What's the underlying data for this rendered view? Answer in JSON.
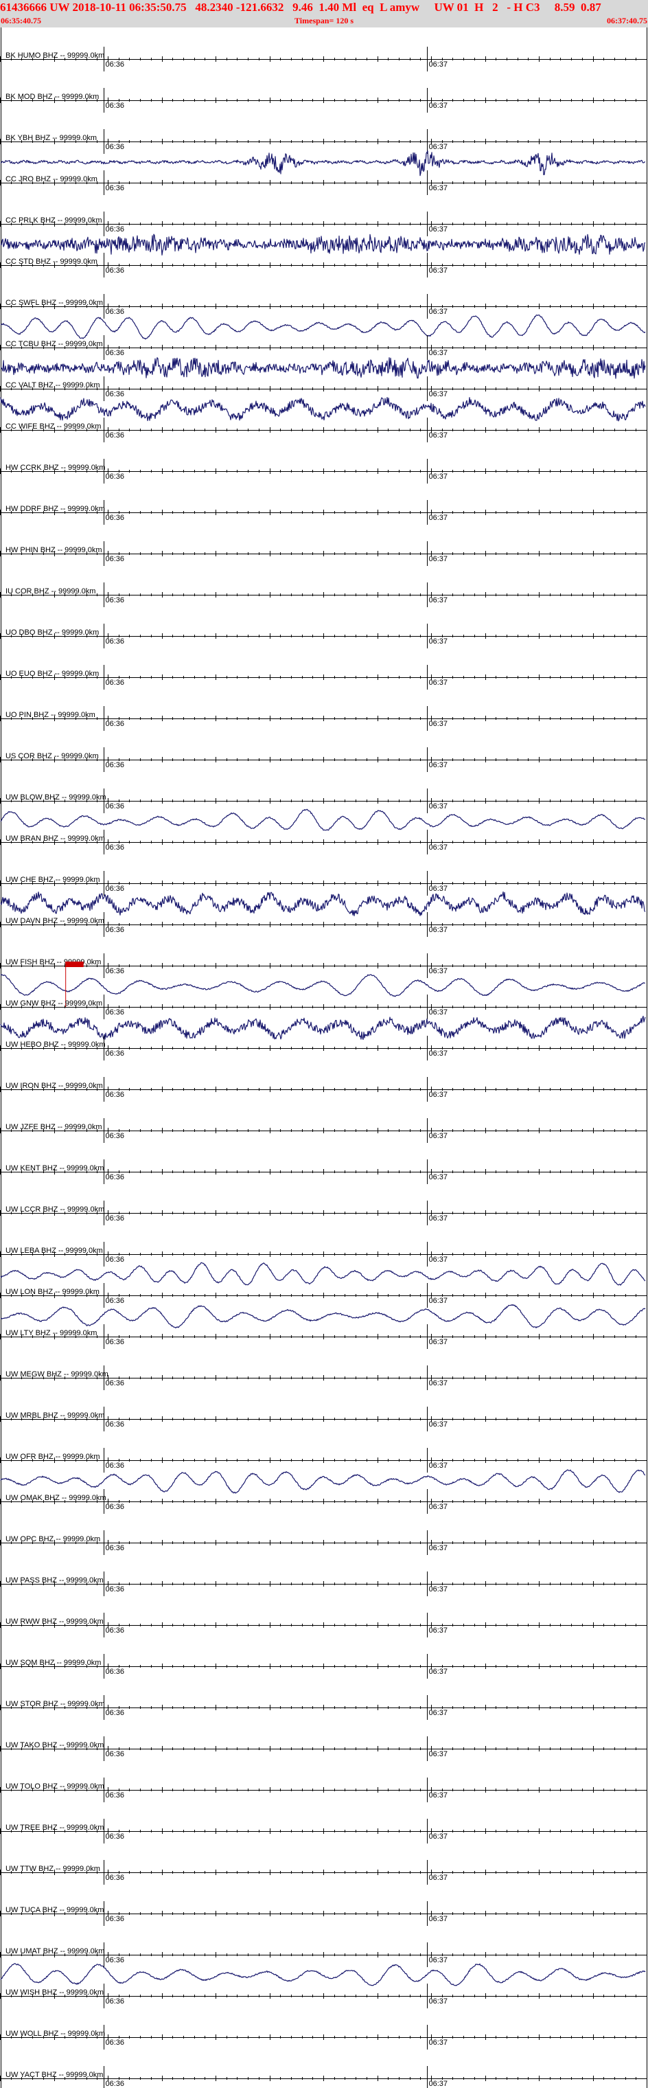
{
  "header": {
    "title_text": "61436666 UW 2018-10-11 06:35:50.75   48.2340 -121.6632   9.46  1.40 Ml  eq  L amyw     UW 01  H   2   - H C3     8.59  0.87",
    "start_time": "06:35:40.75",
    "timespan": "Timespan= 120 s",
    "end_time": "06:37:40.75"
  },
  "colors": {
    "header_background": "#d8d8d8",
    "header_text": "#ff0000",
    "trace": "#1a1a6e",
    "axis": "#000000",
    "pick": "#cc0000"
  },
  "chart_data": {
    "type": "line",
    "title": "61436666 UW 2018-10-11 06:35:50.75   48.2340 -121.6632   9.46  1.40 Ml  eq  L amyw     UW 01  H   2   - H C3     8.59  0.87",
    "x_start": "06:35:40.75",
    "x_end": "06:37:40.75",
    "timespan_seconds": 120,
    "time_tick_labels": [
      "06:36",
      "06:37"
    ],
    "time_tick_seconds": [
      19.25,
      79.25
    ],
    "grid": false,
    "channels": [
      {
        "label": "BK HUMO BHZ -- 99999.0km",
        "waveform": "none"
      },
      {
        "label": "BK MOD BHZ -- 99999.0km",
        "waveform": "none"
      },
      {
        "label": "BK YBH BHZ -- 99999.0km",
        "waveform": "noise-bursts"
      },
      {
        "label": "CC JRO BHZ -- 99999.0km",
        "waveform": "none"
      },
      {
        "label": "CC PRLK BHZ -- 99999.0km",
        "waveform": "high-noise"
      },
      {
        "label": "CC STD BHZ -- 99999.0km",
        "waveform": "none"
      },
      {
        "label": "CC SWFL BHZ -- 99999.0km",
        "waveform": "oscillation"
      },
      {
        "label": "CC TCBU BHZ -- 99999.0km",
        "waveform": "high-noise"
      },
      {
        "label": "CC VALT BHZ -- 99999.0km",
        "waveform": "noisy-oscillation"
      },
      {
        "label": "CC WIFE BHZ -- 99999.0km",
        "waveform": "none"
      },
      {
        "label": "HW CCRK BHZ -- 99999.0km",
        "waveform": "none"
      },
      {
        "label": "HW DDRF BHZ -- 99999.0km",
        "waveform": "none"
      },
      {
        "label": "HW PHIN BHZ -- 99999.0km",
        "waveform": "none"
      },
      {
        "label": "IU COR BHZ -- 99999.0km",
        "waveform": "none"
      },
      {
        "label": "UO DBO BHZ -- 99999.0km",
        "waveform": "none"
      },
      {
        "label": "UO EUO BHZ -- 99999.0km",
        "waveform": "none"
      },
      {
        "label": "UO PIN BHZ -- 99999.0km",
        "waveform": "none"
      },
      {
        "label": "US COR BHZ -- 99999.0km",
        "waveform": "none"
      },
      {
        "label": "UW BLOW BHZ -- 99999.0km",
        "waveform": "oscillation"
      },
      {
        "label": "UW BRAN BHZ -- 99999.0km",
        "waveform": "none"
      },
      {
        "label": "UW CHE BHZ -- 99999.0km",
        "waveform": "noisy-oscillation"
      },
      {
        "label": "UW DAVN BHZ -- 99999.0km",
        "waveform": "none"
      },
      {
        "label": "UW FISH BHZ -- 99999.0km",
        "waveform": "oscillation",
        "pick": true
      },
      {
        "label": "UW GNW BHZ -- 99999.0km",
        "waveform": "noisy-oscillation"
      },
      {
        "label": "UW HEBO BHZ -- 99999.0km",
        "waveform": "none"
      },
      {
        "label": "UW IRON BHZ -- 99999.0km",
        "waveform": "none"
      },
      {
        "label": "UW JZFE BHZ -- 99999.0km",
        "waveform": "none"
      },
      {
        "label": "UW KENT BHZ -- 99999.0km",
        "waveform": "none"
      },
      {
        "label": "UW LCCR BHZ -- 99999.0km",
        "waveform": "none"
      },
      {
        "label": "UW LEBA BHZ -- 99999.0km",
        "waveform": "oscillation"
      },
      {
        "label": "UW LON BHZ -- 99999.0km",
        "waveform": "oscillation"
      },
      {
        "label": "UW LTY BHZ -- 99999.0km",
        "waveform": "none"
      },
      {
        "label": "UW MEGW BHZ -- 99999.0km",
        "waveform": "none"
      },
      {
        "label": "UW MRBL BHZ -- 99999.0km",
        "waveform": "none"
      },
      {
        "label": "UW OFR BHZ -- 99999.0km",
        "waveform": "oscillation"
      },
      {
        "label": "UW OMAK BHZ -- 99999.0km",
        "waveform": "none"
      },
      {
        "label": "UW OPC BHZ -- 99999.0km",
        "waveform": "none"
      },
      {
        "label": "UW PASS BHZ -- 99999.0km",
        "waveform": "none"
      },
      {
        "label": "UW RWW BHZ -- 99999.0km",
        "waveform": "none"
      },
      {
        "label": "UW SQM BHZ -- 99999.0km",
        "waveform": "none"
      },
      {
        "label": "UW STOR BHZ -- 99999.0km",
        "waveform": "none"
      },
      {
        "label": "UW TAKO BHZ -- 99999.0km",
        "waveform": "none"
      },
      {
        "label": "UW TOLO BHZ -- 99999.0km",
        "waveform": "none"
      },
      {
        "label": "UW TREE BHZ -- 99999.0km",
        "waveform": "none"
      },
      {
        "label": "UW TTW BHZ -- 99999.0km",
        "waveform": "none"
      },
      {
        "label": "UW TUCA BHZ -- 99999.0km",
        "waveform": "none"
      },
      {
        "label": "UW UMAT BHZ -- 99999.0km",
        "waveform": "oscillation"
      },
      {
        "label": "UW WISH BHZ -- 99999.0km",
        "waveform": "none"
      },
      {
        "label": "UW WOLL BHZ -- 99999.0km",
        "waveform": "none"
      },
      {
        "label": "UW YACT BHZ -- 99999.0km",
        "waveform": "none"
      }
    ],
    "pick_time_seconds": 15.5
  }
}
